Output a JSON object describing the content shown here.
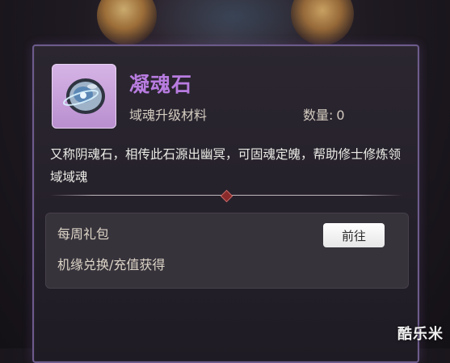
{
  "item": {
    "name": "凝魂石",
    "type": "域魂升级材料",
    "quantity_label": "数量:",
    "quantity_value": "0",
    "description": "又称阴魂石，相传此石源出幽冥，可固魂定魄，帮助修士修炼领域域魂",
    "icon": "soul-stone-icon"
  },
  "source": {
    "title": "每周礼包",
    "description": "机缘兑换/充值获得",
    "button_label": "前往"
  },
  "watermark": "酷乐米",
  "colors": {
    "item_name": "#b87ce0",
    "panel_border": "#6d5b8c",
    "icon_background": "#c9a2dc"
  }
}
